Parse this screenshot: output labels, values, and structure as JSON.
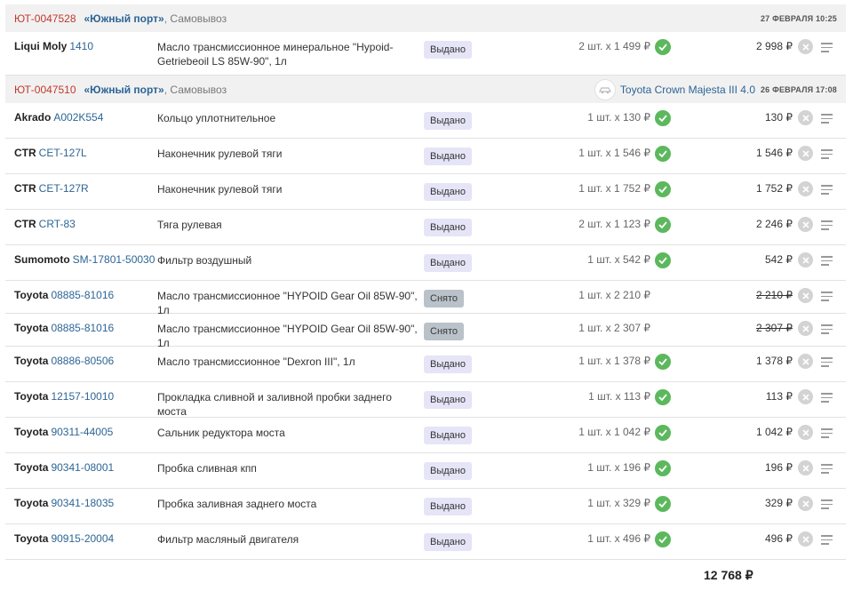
{
  "orders": [
    {
      "id": "ЮТ-0047528",
      "store": "«Южный порт»",
      "delivery": ", Самовывоз",
      "date": "27 ФЕВРАЛЯ 10:25",
      "car": "",
      "items": [
        {
          "brand": "Liqui Moly",
          "article": "1410",
          "desc": "Масло трансмиссионное минеральное \"Hypoid-Getriebeoil LS 85W-90\", 1л",
          "status": "Выдано",
          "status_type": "issued",
          "qty": "2 шт. x 1 499 ₽",
          "check": true,
          "total": "2 998 ₽",
          "struck": false,
          "size": "tall"
        }
      ]
    },
    {
      "id": "ЮТ-0047510",
      "store": "«Южный порт»",
      "delivery": ", Самовывоз",
      "date": "26 ФЕВРАЛЯ 17:08",
      "car": "Toyota Crown Majesta III 4.0",
      "items": [
        {
          "brand": "Akrado",
          "article": "A002K554",
          "desc": "Кольцо уплотнительное",
          "status": "Выдано",
          "status_type": "issued",
          "qty": "1 шт. x 130 ₽",
          "check": true,
          "total": "130 ₽",
          "struck": false,
          "size": "normal"
        },
        {
          "brand": "CTR",
          "article": "CET-127L",
          "desc": "Наконечник рулевой тяги",
          "status": "Выдано",
          "status_type": "issued",
          "qty": "1 шт. x 1 546 ₽",
          "check": true,
          "total": "1 546 ₽",
          "struck": false,
          "size": "normal"
        },
        {
          "brand": "CTR",
          "article": "CET-127R",
          "desc": "Наконечник рулевой тяги",
          "status": "Выдано",
          "status_type": "issued",
          "qty": "1 шт. x 1 752 ₽",
          "check": true,
          "total": "1 752 ₽",
          "struck": false,
          "size": "normal"
        },
        {
          "brand": "CTR",
          "article": "CRT-83",
          "desc": "Тяга рулевая",
          "status": "Выдано",
          "status_type": "issued",
          "qty": "2 шт. x 1 123 ₽",
          "check": true,
          "total": "2 246 ₽",
          "struck": false,
          "size": "normal"
        },
        {
          "brand": "Sumomoto",
          "article": "SM-17801-50030",
          "desc": "Фильтр воздушный",
          "status": "Выдано",
          "status_type": "issued",
          "qty": "1 шт. x 542 ₽",
          "check": true,
          "total": "542 ₽",
          "struck": false,
          "size": "normal"
        },
        {
          "brand": "Toyota",
          "article": "08885-81016",
          "desc": "Масло трансмиссионное \"HYPOID Gear Oil 85W-90\", 1л",
          "status": "Снято",
          "status_type": "removed",
          "qty": "1 шт. x 2 210 ₽",
          "check": false,
          "total": "2 210 ₽",
          "struck": true,
          "size": "short"
        },
        {
          "brand": "Toyota",
          "article": "08885-81016",
          "desc": "Масло трансмиссионное \"HYPOID Gear Oil 85W-90\", 1л",
          "status": "Снято",
          "status_type": "removed",
          "qty": "1 шт. x 2 307 ₽",
          "check": false,
          "total": "2 307 ₽",
          "struck": true,
          "size": "short"
        },
        {
          "brand": "Toyota",
          "article": "08886-80506",
          "desc": "Масло трансмиссионное \"Dexron III\", 1л",
          "status": "Выдано",
          "status_type": "issued",
          "qty": "1 шт. x 1 378 ₽",
          "check": true,
          "total": "1 378 ₽",
          "struck": false,
          "size": "normal"
        },
        {
          "brand": "Toyota",
          "article": "12157-10010",
          "desc": "Прокладка сливной и заливной пробки заднего моста",
          "status": "Выдано",
          "status_type": "issued",
          "qty": "1 шт. x 113 ₽",
          "check": true,
          "total": "113 ₽",
          "struck": false,
          "size": "normal"
        },
        {
          "brand": "Toyota",
          "article": "90311-44005",
          "desc": "Сальник редуктора моста",
          "status": "Выдано",
          "status_type": "issued",
          "qty": "1 шт. x 1 042 ₽",
          "check": true,
          "total": "1 042 ₽",
          "struck": false,
          "size": "normal"
        },
        {
          "brand": "Toyota",
          "article": "90341-08001",
          "desc": "Пробка сливная кпп",
          "status": "Выдано",
          "status_type": "issued",
          "qty": "1 шт. x 196 ₽",
          "check": true,
          "total": "196 ₽",
          "struck": false,
          "size": "normal"
        },
        {
          "brand": "Toyota",
          "article": "90341-18035",
          "desc": "Пробка заливная заднего моста",
          "status": "Выдано",
          "status_type": "issued",
          "qty": "1 шт. x 329 ₽",
          "check": true,
          "total": "329 ₽",
          "struck": false,
          "size": "normal"
        },
        {
          "brand": "Toyota",
          "article": "90915-20004",
          "desc": "Фильтр масляный двигателя",
          "status": "Выдано",
          "status_type": "issued",
          "qty": "1 шт. x 496 ₽",
          "check": true,
          "total": "496 ₽",
          "struck": false,
          "size": "normal"
        }
      ]
    }
  ],
  "grand_total": "12 768 ₽",
  "icons": {
    "check": "check-circle-icon",
    "remove": "remove-circle-icon",
    "menu": "menu-lines-icon",
    "car": "car-icon"
  },
  "colors": {
    "order_id": "#c0392b",
    "link": "#2d6596",
    "check": "#5cb85c",
    "issued_badge": "#e6e4f7",
    "removed_badge": "#b9c2c9"
  }
}
